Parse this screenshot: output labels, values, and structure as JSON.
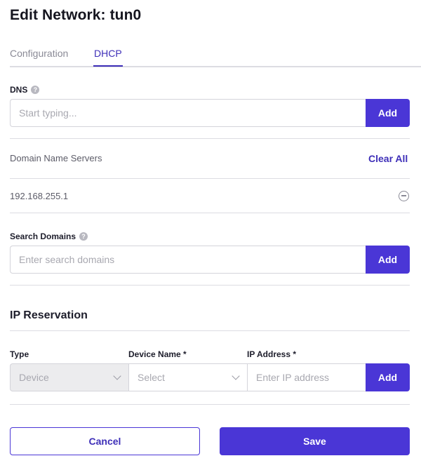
{
  "page": {
    "title": "Edit Network: tun0"
  },
  "tabs": [
    {
      "label": "Configuration",
      "active": false
    },
    {
      "label": "DHCP",
      "active": true
    }
  ],
  "dns": {
    "label": "DNS",
    "help_icon": "help-circle-icon",
    "placeholder": "Start typing...",
    "add_label": "Add"
  },
  "servers": {
    "heading": "Domain Name Servers",
    "clear_all_label": "Clear All",
    "items": [
      {
        "value": "192.168.255.1",
        "remove_icon": "minus-circle-icon"
      }
    ]
  },
  "search_domains": {
    "label": "Search Domains",
    "help_icon": "help-circle-icon",
    "placeholder": "Enter search domains",
    "add_label": "Add"
  },
  "ip_reservation": {
    "title": "IP Reservation",
    "type_label": "Type",
    "device_name_label": "Device Name *",
    "ip_address_label": "IP Address *",
    "type_value": "Device",
    "device_placeholder": "Select",
    "ip_placeholder": "Enter IP address",
    "add_label": "Add"
  },
  "actions": {
    "cancel_label": "Cancel",
    "save_label": "Save"
  },
  "colors": {
    "accent": "#4a36d6",
    "tab_active": "#3e2fb8",
    "divider": "#dcdce2"
  }
}
